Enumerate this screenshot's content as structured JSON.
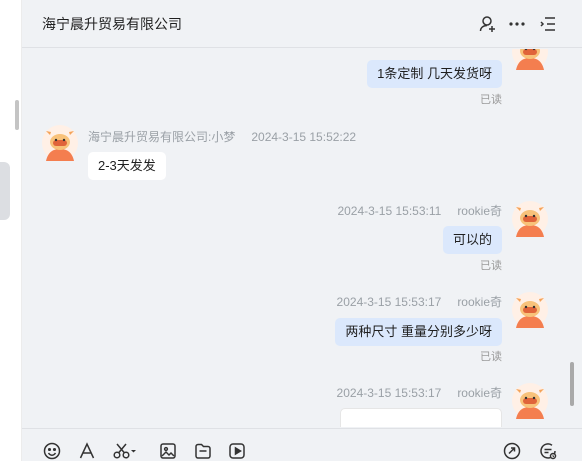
{
  "header": {
    "title": "海宁晨升贸易有限公司",
    "icons": [
      "add-user-icon",
      "more-icon",
      "list-icon"
    ]
  },
  "messages": [
    {
      "direction": "out",
      "text": "1条定制  几天发货呀",
      "read": "已读"
    },
    {
      "direction": "in",
      "sender": "海宁晨升贸易有限公司:小梦",
      "time": "2024-3-15 15:52:22",
      "text": "2-3天发发"
    },
    {
      "direction": "out",
      "sender": "rookie奇",
      "time": "2024-3-15 15:53:11",
      "text": "可以的",
      "read": "已读"
    },
    {
      "direction": "out",
      "sender": "rookie奇",
      "time": "2024-3-15 15:53:17",
      "text": "两种尺寸 重量分别多少呀",
      "read": "已读"
    },
    {
      "direction": "out",
      "sender": "rookie奇",
      "time": "2024-3-15 15:53:17",
      "text": ""
    }
  ],
  "toolbar": {
    "icons": [
      "emoji-icon",
      "font-icon",
      "scissors-icon",
      "image-icon",
      "file-icon",
      "video-icon",
      "quick-reply-icon",
      "chat-history-icon"
    ]
  },
  "colors": {
    "panel_bg": "#f0f2f5",
    "outgoing_bubble": "#dbe8fc",
    "incoming_bubble": "#ffffff",
    "avatar_orange": "#f47e4f"
  }
}
